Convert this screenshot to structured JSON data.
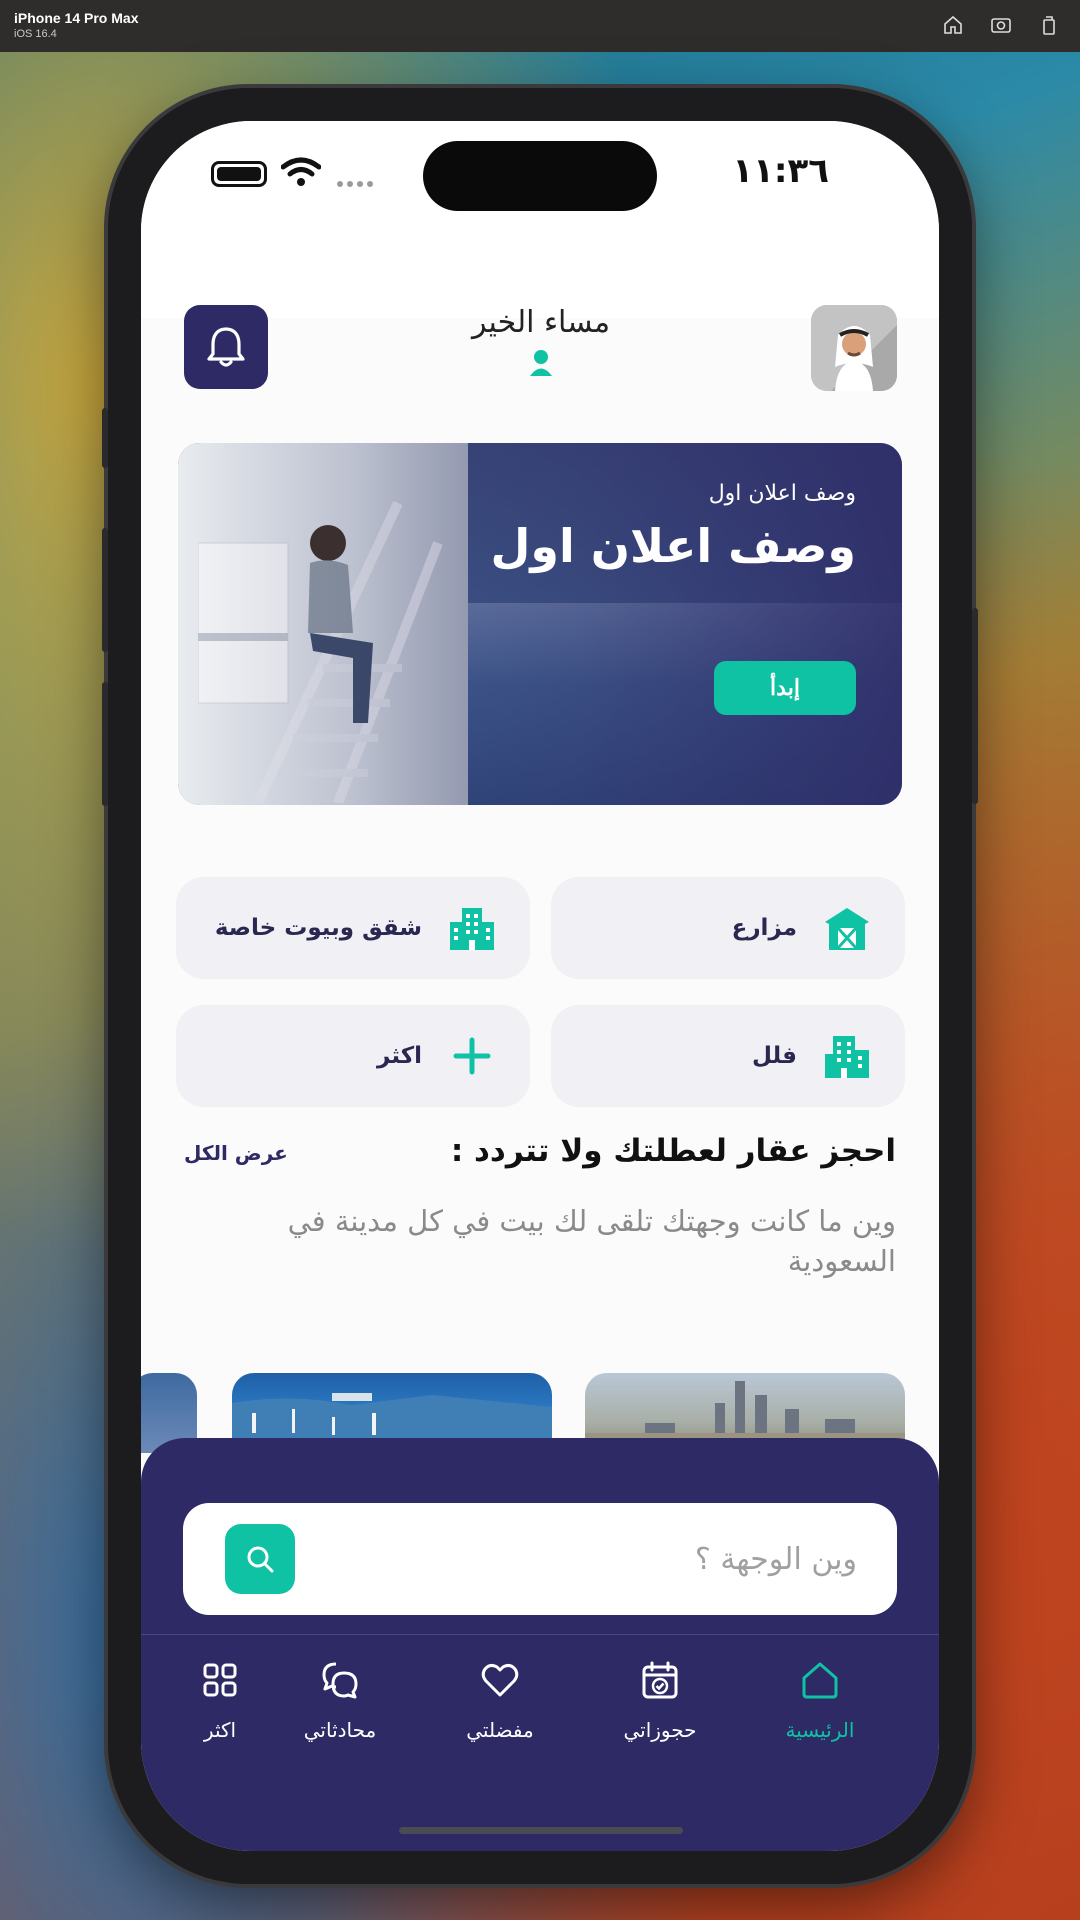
{
  "simulator": {
    "device": "iPhone 14 Pro Max",
    "os": "iOS 16.4"
  },
  "status_bar": {
    "time": "١١:٣٦"
  },
  "header": {
    "greeting": "مساء الخير"
  },
  "banner": {
    "subtitle": "وصف اعلان اول",
    "title": "وصف اعلان اول",
    "cta": "إبدأ"
  },
  "categories": [
    {
      "label": "شقق وبيوت خاصة",
      "icon": "building-icon"
    },
    {
      "label": "مزارع",
      "icon": "barn-icon"
    },
    {
      "label": "اكثر",
      "icon": "plus-icon"
    },
    {
      "label": "فلل",
      "icon": "building-icon"
    }
  ],
  "section": {
    "title": "احجز عقار لعطلتك ولا تتردد :",
    "see_all": "عرض الكل",
    "description": "وين ما كانت وجهتك تلقى لك بيت في كل مدينة في السعودية"
  },
  "search": {
    "placeholder": "وين الوجهة ؟"
  },
  "nav": [
    {
      "label": "الرئيسية",
      "icon": "home-icon",
      "active": true
    },
    {
      "label": "حجوزاتي",
      "icon": "calendar-check-icon",
      "active": false
    },
    {
      "label": "مفضلتي",
      "icon": "heart-icon",
      "active": false
    },
    {
      "label": "محادثاتي",
      "icon": "chat-icon",
      "active": false
    },
    {
      "label": "اكثر",
      "icon": "grid-icon",
      "active": false
    }
  ],
  "colors": {
    "primary": "#2e2a66",
    "accent": "#0fc2a3",
    "background": "#fbfbfc"
  }
}
